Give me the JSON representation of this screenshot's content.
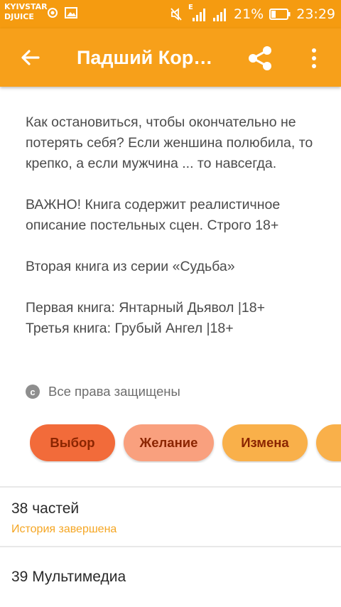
{
  "status_bar": {
    "carrier_line1": "KYIVSTAR",
    "carrier_line2": "DJUICE",
    "network_label": "E",
    "battery": "21%",
    "time": "23:29"
  },
  "app_bar": {
    "title": "Падший Король",
    "icons": [
      "arrow-back-icon",
      "share-icon",
      "more-vert-icon"
    ]
  },
  "description": {
    "paragraphs": [
      "Как остановиться, чтобы окончательно не потерять себя? Если женшина полюбила, то крепко, а если мужчина ... то навсегда.",
      "ВАЖНО! Книга содержит реалистичное описание постельных сцен. Строго 18+",
      "Вторая книга из серии «Судьба»",
      "Первая книга: Янтарный Дьявол |18+ Третья книга: Грубый Ангел |18+"
    ]
  },
  "rights": {
    "icon": "copyright-icon",
    "text": "Все права защищены"
  },
  "tags": [
    {
      "label": "Выбор",
      "color": "#f26b3a"
    },
    {
      "label": "Желание",
      "color": "#f9a07e"
    },
    {
      "label": "Измена",
      "color": "#f9b04a"
    },
    {
      "label": "",
      "color": "#f9b04a"
    }
  ],
  "parts": {
    "label": "38 частей",
    "status": "История завершена",
    "status_color": "#f5a623"
  },
  "media": {
    "label": "39 Мультимедиа"
  },
  "colors": {
    "status_bar": "#f59b10",
    "app_bar": "#f7a01a"
  }
}
